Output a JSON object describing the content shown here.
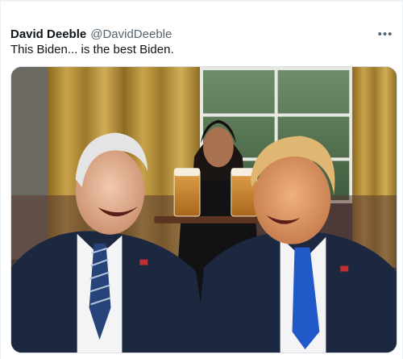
{
  "tweet": {
    "author": {
      "display_name": "David Deeble",
      "handle": "@DavidDeeble"
    },
    "text": "This Biden... is the best Biden.",
    "more_icon": "more-horizontal-icon",
    "media": {
      "type": "image",
      "depicts": "illustration"
    }
  },
  "colors": {
    "text_primary": "#0f1419",
    "text_secondary": "#536471",
    "border": "#d9e1e7"
  }
}
